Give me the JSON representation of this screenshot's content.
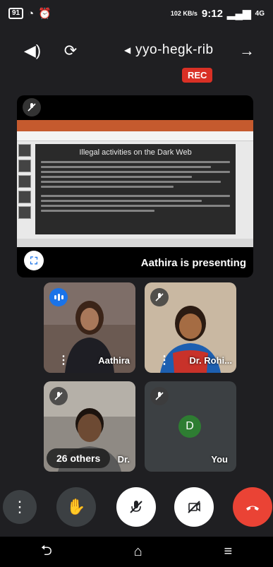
{
  "status_bar": {
    "time": "9:12",
    "battery": "91",
    "net_speed": "102 KB/s",
    "network": "4G"
  },
  "header": {
    "meeting_code": "yyo-hegk-rib",
    "rec_label": "REC"
  },
  "presentation": {
    "presenting_label": "Aathira is presenting",
    "slide_title": "Illegal activities on the Dark Web"
  },
  "participants": [
    {
      "name": "Aathira",
      "speaking": true
    },
    {
      "name": "Dr. Rohi...",
      "muted": true
    },
    {
      "name": "Dr.",
      "muted": true
    },
    {
      "name": "You",
      "avatar_letter": "D",
      "muted": true
    }
  ],
  "others": "26 others",
  "controls": [
    "more-options",
    "raise-hand",
    "microphone-off",
    "camera-off",
    "end-call"
  ],
  "colors": {
    "accent": "#1a73e8",
    "end_call": "#ea4335",
    "rec": "#d93025",
    "tile_bg": "#3c4043",
    "avatar_you": "#2e7d32"
  }
}
